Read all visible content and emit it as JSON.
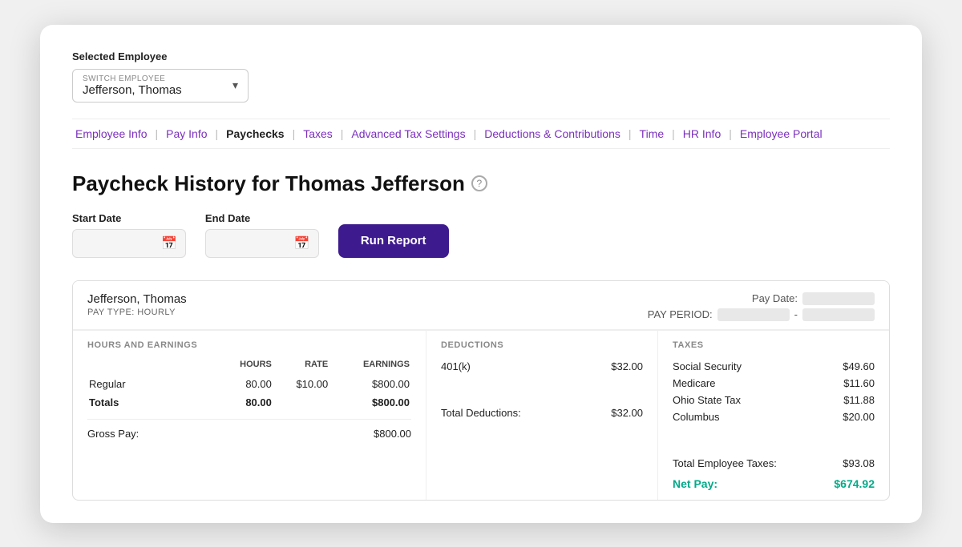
{
  "background": {
    "blob_color": "#7b2fbe"
  },
  "card": {
    "selected_employee_label": "Selected Employee",
    "switch_label": "SWITCH EMPLOYEE",
    "employee_name": "Jefferson, Thomas",
    "chevron": "▾"
  },
  "nav": {
    "items": [
      {
        "label": "Employee Info",
        "active": false
      },
      {
        "label": "Pay Info",
        "active": false
      },
      {
        "label": "Paychecks",
        "active": true
      },
      {
        "label": "Taxes",
        "active": false
      },
      {
        "label": "Advanced Tax Settings",
        "active": false
      },
      {
        "label": "Deductions & Contributions",
        "active": false
      },
      {
        "label": "Time",
        "active": false
      },
      {
        "label": "HR Info",
        "active": false
      },
      {
        "label": "Employee Portal",
        "active": false
      }
    ]
  },
  "page": {
    "title": "Paycheck History for Thomas Jefferson",
    "help_icon": "?",
    "start_date_label": "Start Date",
    "end_date_label": "End Date",
    "run_report_label": "Run Report"
  },
  "paycheck": {
    "employee_name": "Jefferson, Thomas",
    "pay_type": "PAY TYPE: HOURLY",
    "pay_date_label": "Pay Date:",
    "pay_period_label": "PAY PERIOD:",
    "pay_period_dash": "-",
    "hours_earnings_header": "HOURS AND EARNINGS",
    "col_hours": "HOURS",
    "col_rate": "RATE",
    "col_earnings": "EARNINGS",
    "rows": [
      {
        "label": "Regular",
        "hours": "80.00",
        "rate": "$10.00",
        "earnings": "$800.00"
      }
    ],
    "totals_label": "Totals",
    "totals_hours": "80.00",
    "totals_earnings": "$800.00",
    "gross_pay_label": "Gross Pay:",
    "gross_pay_val": "$800.00",
    "deductions_header": "DEDUCTIONS",
    "deductions": [
      {
        "label": "401(k)",
        "amount": "$32.00"
      }
    ],
    "total_deductions_label": "Total Deductions:",
    "total_deductions_val": "$32.00",
    "taxes_header": "TAXES",
    "taxes": [
      {
        "label": "Social Security",
        "amount": "$49.60"
      },
      {
        "label": "Medicare",
        "amount": "$11.60"
      },
      {
        "label": "Ohio State Tax",
        "amount": "$11.88"
      },
      {
        "label": "Columbus",
        "amount": "$20.00"
      }
    ],
    "total_taxes_label": "Total Employee Taxes:",
    "total_taxes_val": "$93.08",
    "net_pay_label": "Net Pay:",
    "net_pay_val": "$674.92"
  }
}
